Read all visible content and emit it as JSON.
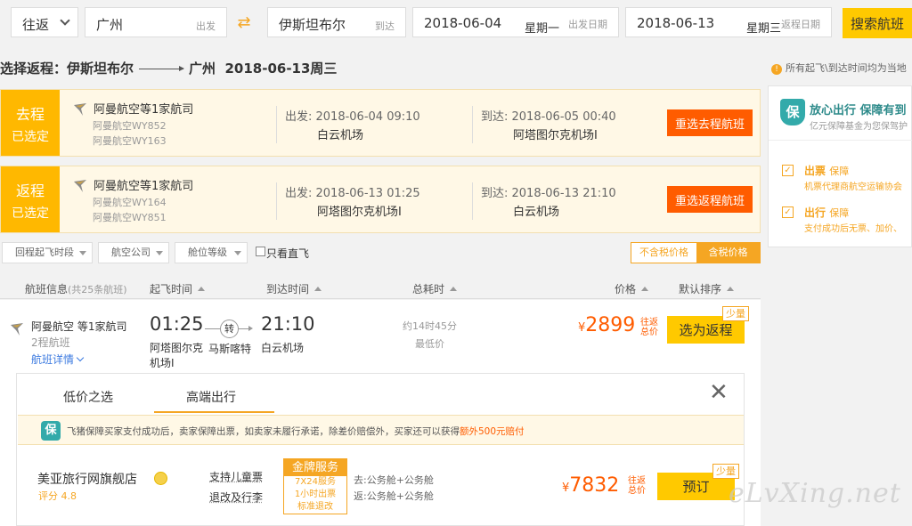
{
  "search": {
    "trip_type": "往返",
    "from_city": "广州",
    "from_hint": "出发",
    "to_city": "伊斯坦布尔",
    "to_hint": "到达",
    "depart_date": "2018-06-04",
    "depart_weekday": "星期一",
    "depart_hint": "出发日期",
    "return_date": "2018-06-13",
    "return_weekday": "星期三",
    "return_hint": "返程日期",
    "search_label": "搜索航班"
  },
  "return_title": {
    "prefix": "选择返程：伊斯坦布尔",
    "dest": "广州",
    "date": "2018-06-13周三"
  },
  "outbound": {
    "tag_1": "去程",
    "tag_2": "已选定",
    "airline": "阿曼航空等1家航司",
    "flight_1": "阿曼航空WY852",
    "flight_2": "阿曼航空WY163",
    "dep_label": "出发: 2018-06-04 09:10",
    "dep_airport": "白云机场",
    "arr_label": "到达: 2018-06-05 00:40",
    "arr_airport": "阿塔图尔克机场I",
    "reselect": "重选去程航班"
  },
  "inbound": {
    "tag_1": "返程",
    "tag_2": "已选定",
    "airline": "阿曼航空等1家航司",
    "flight_1": "阿曼航空WY164",
    "flight_2": "阿曼航空WY851",
    "dep_label": "出发: 2018-06-13 01:25",
    "dep_airport": "阿塔图尔克机场I",
    "arr_label": "到达: 2018-06-13 21:10",
    "arr_airport": "白云机场",
    "reselect": "重选返程航班"
  },
  "filters": {
    "dep_time": "回程起飞时段",
    "airline": "航空公司",
    "cabin": "舱位等级",
    "direct_only": "只看直飞",
    "tax_excl": "不含税价格",
    "tax_incl": "含税价格"
  },
  "table_header": {
    "info": "航班信息",
    "count": "(共25条航班)",
    "dep_time": "起飞时间",
    "arr_time": "到达时间",
    "duration": "总耗时",
    "price": "价格",
    "sort": "默认排序"
  },
  "flight": {
    "airline": "阿曼航空 等1家航司",
    "legs": "2程航班",
    "details": "航班详情",
    "dep_time": "01:25",
    "dep_airport_1": "阿塔图尔克",
    "dep_airport_2": "机场I",
    "transfer": "转",
    "transfer_city": "马斯喀特",
    "arr_time": "21:10",
    "arr_airport": "白云机场",
    "duration": "约14时45分",
    "lowest": "最低价",
    "currency": "¥",
    "price": "2899",
    "price_note": "往返总价",
    "select": "选为返程",
    "few": "少量"
  },
  "panel": {
    "tab_low": "低价之选",
    "tab_premium": "高端出行",
    "close": "✕",
    "notice": "飞猪保障买家支付成功后，卖家保障出票，如卖家未履行承诺，除差价赔偿外，买家还可以获得",
    "notice_highlight": "额外500元赔付",
    "shop": "美亚旅行网旗舰店",
    "score": "评分 4.8",
    "feature_1": "支持儿童票",
    "feature_2": "退改及行李",
    "gold_title": "金牌服务",
    "gold_1": "7X24服务",
    "gold_2": "1小时出票",
    "gold_3": "标准退改",
    "route_go": "去:公务舱+公务舱",
    "route_back": "返:公务舱+公务舱",
    "currency": "¥",
    "price": "7832",
    "price_note": "往返总价",
    "book": "预订",
    "few": "少量"
  },
  "right": {
    "note": "所有起飞\\到达时间均为当地",
    "title": "放心出行 保障有到",
    "subtitle": "亿元保障基金为您保驾护",
    "item1_title": "出票",
    "item1_tag": "保障",
    "item1_desc": "机票代理商航空运输协会",
    "item2_title": "出行",
    "item2_tag": "保障",
    "item2_desc": "支付成功后无票、加价、"
  },
  "watermark": "eLvXing.net"
}
